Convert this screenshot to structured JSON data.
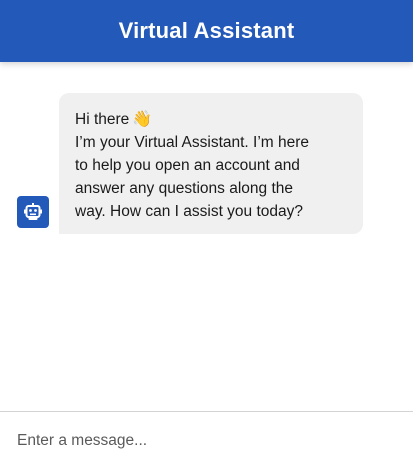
{
  "header": {
    "title": "Virtual Assistant",
    "background_color": "#2359b8"
  },
  "messages": [
    {
      "sender": "bot",
      "avatar_icon": "robot-icon",
      "lines": [
        "Hi there",
        "I’m your Virtual Assistant. I’m here",
        "to help you open an account and",
        "answer any questions along the",
        "way. How can I assist you today?"
      ],
      "emoji": "👋"
    }
  ],
  "composer": {
    "placeholder": "Enter a message..."
  }
}
